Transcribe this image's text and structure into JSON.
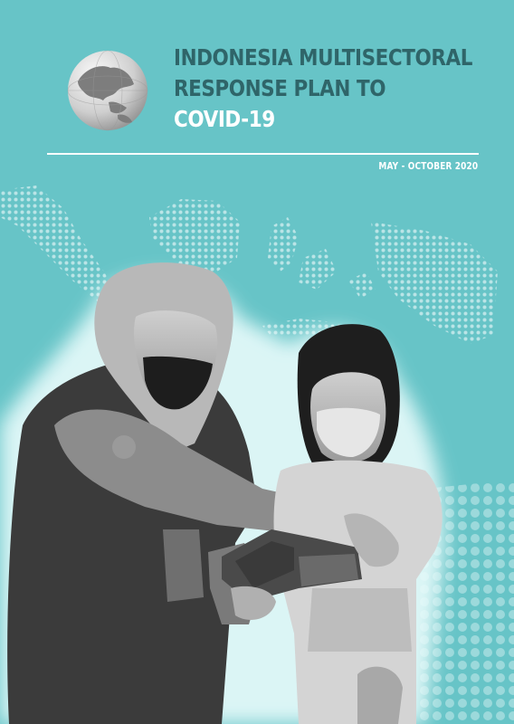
{
  "title": {
    "line1": "INDONESIA MULTISECTORAL",
    "line2": "RESPONSE PLAN TO",
    "line3": "COVID-19"
  },
  "date_range": "MAY - OCTOBER 2020",
  "colors": {
    "background": "#67c4c7",
    "title_dark": "#2f6569",
    "title_light": "#ffffff"
  },
  "icons": [
    "globe-icon"
  ]
}
